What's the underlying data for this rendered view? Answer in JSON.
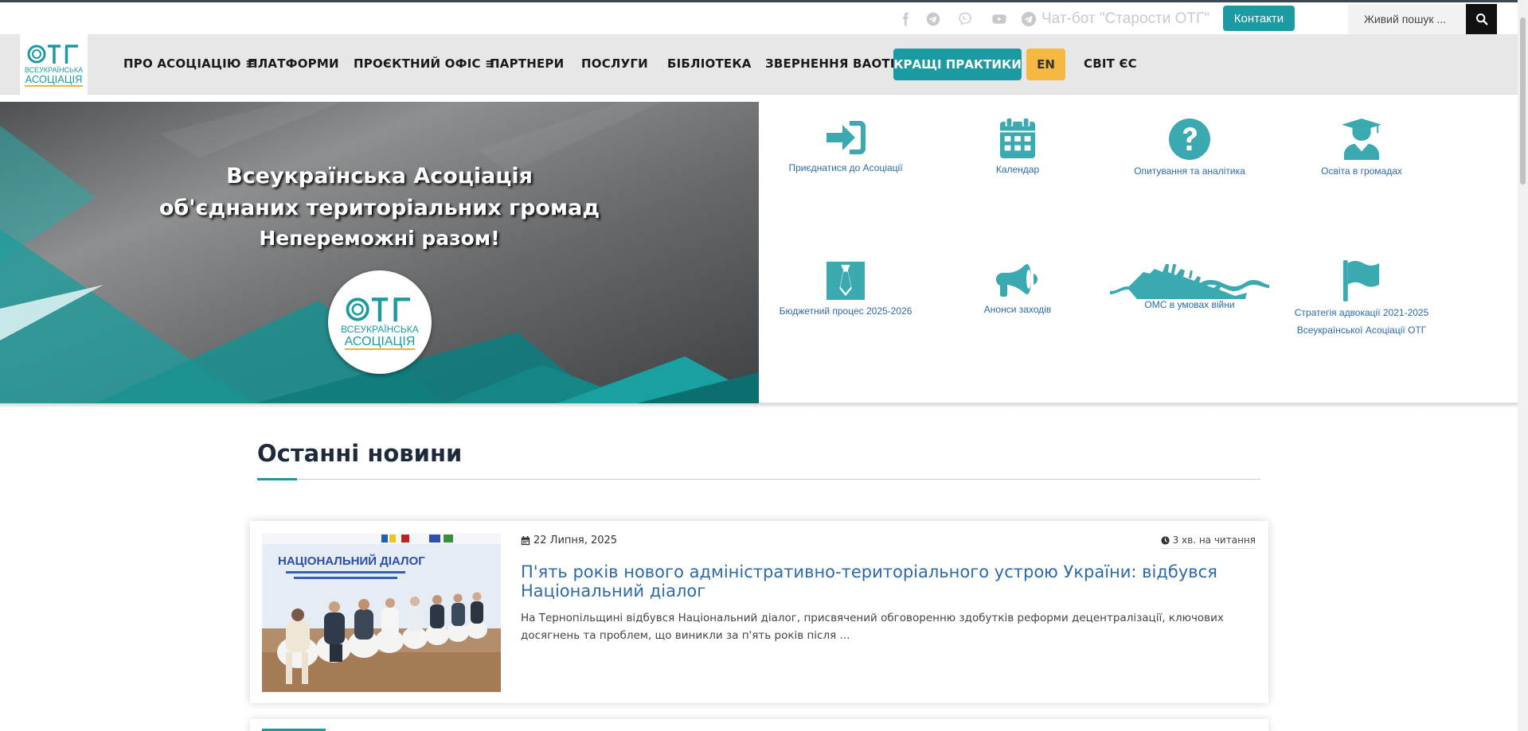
{
  "topbar": {
    "social_icons": [
      "facebook-icon",
      "telegram-icon",
      "viber-icon",
      "youtube-icon"
    ],
    "chatbot_label": "Чат-бот \"Старости ОТГ\"",
    "contacts_label": "Контакти",
    "search_placeholder": "Живий пошук ..."
  },
  "logo": {
    "mark": "ОТГ",
    "line1": "ВСЕУКРАЇНСЬКА",
    "line2": "АСОЦІАЦІЯ"
  },
  "nav": {
    "items": [
      {
        "label": "ПРО АСОЦІАЦІЮ ≡"
      },
      {
        "label": "ПЛАТФОРМИ"
      },
      {
        "label": "ПРОЄКТНИЙ ОФІС ≡"
      },
      {
        "label": "ПАРТНЕРИ"
      },
      {
        "label": "ПОСЛУГИ"
      },
      {
        "label": "БІБЛІОТЕКА"
      },
      {
        "label": "ЗВЕРНЕННЯ ВАОТГ"
      }
    ],
    "best_practices_label": "КРАЩІ ПРАКТИКИ",
    "lang_label": "EN",
    "eu_label": "СВІТ ЄС"
  },
  "hero": {
    "title_line1": "Всеукраїнська Асоціація",
    "title_line2": "об'єднаних територіальних громад",
    "slogan": "Непереможні разом!",
    "logo_line1": "ВСЕУКРАЇНСЬКА",
    "logo_line2": "АСОЦІАЦІЯ"
  },
  "quick_links": [
    {
      "label": "Приєднатися до Асоціації",
      "icon": "sign-in-icon"
    },
    {
      "label": "Календар",
      "icon": "calendar-icon"
    },
    {
      "label": "Опитування та аналітика",
      "icon": "question-circle-icon"
    },
    {
      "label": "Освіта в громадах",
      "icon": "graduate-icon"
    },
    {
      "label": "Бюджетний процес 2025-2026",
      "icon": "tie-icon"
    },
    {
      "label": "Анонси заходів",
      "icon": "megaphone-icon"
    },
    {
      "label": "ОМС в умовах війни",
      "icon": "sinking-ship-icon"
    },
    {
      "label": "Стратегія адвокації 2021-2025",
      "label2": "Всеукраїнської Асоціації ОТГ",
      "icon": "flag-icon"
    }
  ],
  "news": {
    "heading": "Останні новини",
    "articles": [
      {
        "date": "22 Липня, 2025",
        "read_time": "3 хв. на читання",
        "title": "П'ять років нового адміністративно-територіального устрою України: відбувся Національний діалог",
        "excerpt": "На Тернопільщині відбувся Національний діалог, присвячений обговоренню здобутків реформи децентралізації, ключових досягнень та проблем, що виникли за п'ять років після ...",
        "image_banner_text": "НАЦІОНАЛЬНИЙ ДІАЛОГ"
      }
    ]
  },
  "colors": {
    "accent": "#1b9aa2",
    "lang_button": "#f5b942",
    "link": "#2c6aa8",
    "icon": "#3aa9b0"
  }
}
